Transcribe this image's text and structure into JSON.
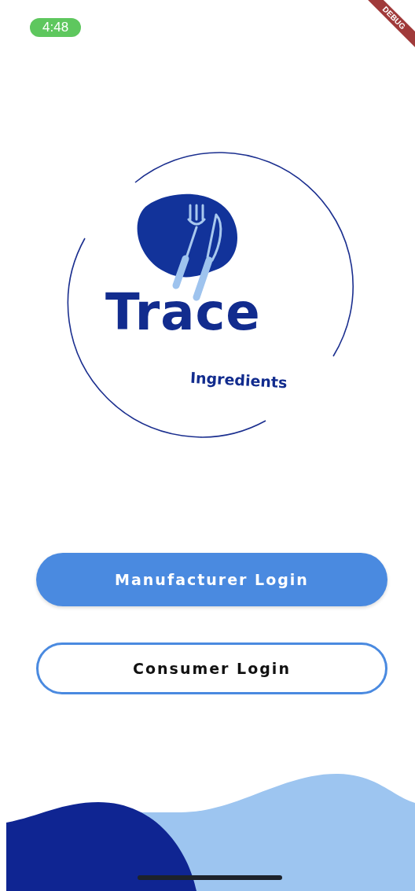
{
  "status_bar": {
    "time": "4:48"
  },
  "debug_banner": {
    "label": "DEBUG"
  },
  "logo": {
    "title": "Trace",
    "subtitle": "Ingredients"
  },
  "buttons": [
    {
      "label": "Manufacturer Login",
      "kind": "filled"
    },
    {
      "label": "Consumer Login",
      "kind": "outlined"
    }
  ]
}
